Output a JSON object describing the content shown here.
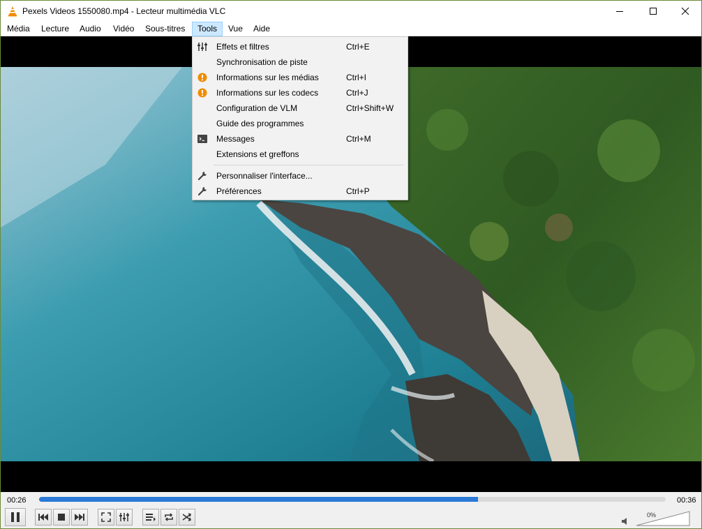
{
  "window": {
    "title": "Pexels Videos 1550080.mp4 - Lecteur multimédia VLC"
  },
  "menubar": {
    "items": [
      {
        "label": "Média"
      },
      {
        "label": "Lecture"
      },
      {
        "label": "Audio"
      },
      {
        "label": "Vidéo"
      },
      {
        "label": "Sous-titres"
      },
      {
        "label": "Tools"
      },
      {
        "label": "Vue"
      },
      {
        "label": "Aide"
      }
    ]
  },
  "tools_menu": {
    "items": [
      {
        "label": "Effets et filtres",
        "shortcut": "Ctrl+E",
        "icon": "equalizer-icon"
      },
      {
        "label": "Synchronisation de piste",
        "shortcut": "",
        "icon": ""
      },
      {
        "label": "Informations sur les médias",
        "shortcut": "Ctrl+I",
        "icon": "info-icon"
      },
      {
        "label": "Informations sur les codecs",
        "shortcut": "Ctrl+J",
        "icon": "info-icon"
      },
      {
        "label": "Configuration de VLM",
        "shortcut": "Ctrl+Shift+W",
        "icon": ""
      },
      {
        "label": "Guide des programmes",
        "shortcut": "",
        "icon": ""
      },
      {
        "label": "Messages",
        "shortcut": "Ctrl+M",
        "icon": "terminal-icon"
      },
      {
        "label": "Extensions et greffons",
        "shortcut": "",
        "icon": ""
      },
      {
        "label": "Personnaliser l'interface...",
        "shortcut": "",
        "icon": "wrench-icon"
      },
      {
        "label": "Préférences",
        "shortcut": "Ctrl+P",
        "icon": "wrench-icon"
      }
    ]
  },
  "player": {
    "elapsed": "00:26",
    "remaining": "00:36",
    "progress": 0.7,
    "volume_label": "0%"
  },
  "colors": {
    "accent": "#2a7ad6",
    "menu_highlight": "#cce8ff",
    "vlc_orange": "#f08c00"
  }
}
